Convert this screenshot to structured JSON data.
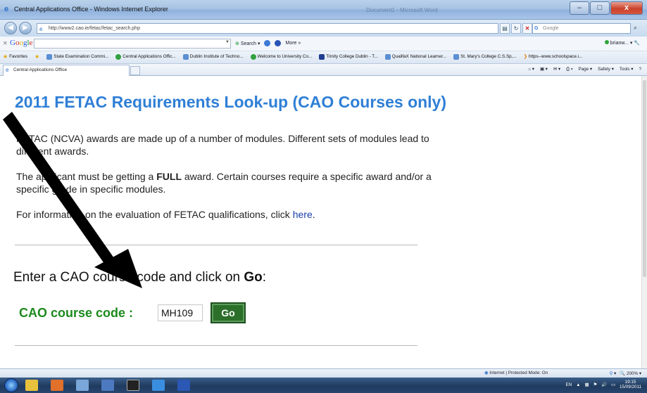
{
  "window": {
    "title": "Central Applications Office - Windows Internet Explorer",
    "ghost_tab": "Document1 - Microsoft Word",
    "minimize": "–",
    "maximize": "□",
    "close": "x"
  },
  "address_bar": {
    "url": "http://www2.cao.ie/fetac/fetac_search.php",
    "search_placeholder": "Google"
  },
  "google_toolbar": {
    "logo": [
      "G",
      "o",
      "o",
      "g",
      "l",
      "e"
    ],
    "search_label": "Search",
    "more_label": "More »",
    "user": "brianw..."
  },
  "favorites_bar": {
    "label": "Favorites",
    "items": [
      "State Examination Commi...",
      "Central Applications Offic...",
      "Dublin Institute of Techno...",
      "Welcome to University Co...",
      "Trinity College Dublin - T...",
      "QualifaX National Learner...",
      "St. Mary's College C.S.Sp,...",
      "https--www.schoolspace.i..."
    ]
  },
  "tab": {
    "label": "Central Applications Office"
  },
  "command_bar": {
    "page": "Page ▾",
    "safety": "Safety ▾",
    "tools": "Tools ▾",
    "help": "?"
  },
  "page": {
    "heading": "2011 FETAC Requirements Look-up (CAO Courses only)",
    "para1": "FETAC (NCVA) awards are made up of a number of modules. Different sets of modules lead to different awards.",
    "para2_before": "The applicant must be getting a ",
    "para2_bold": "FULL",
    "para2_after": " award. Certain courses require a specific award and/or a specific grade in specific modules.",
    "para3_before": "For information on the evaluation of FETAC qualifications, click ",
    "para3_link": "here",
    "para3_after": ".",
    "instruction_before": "Enter a CAO course code and click on ",
    "instruction_bold": "Go",
    "instruction_after": ":",
    "code_label": "CAO course code :",
    "code_value": "MH109",
    "go_button": "Go"
  },
  "status_bar": {
    "zone": "Internet | Protected Mode: On",
    "zoom": "200%"
  },
  "taskbar": {
    "language": "EN",
    "time": "19:15",
    "date": "15/09/2011"
  },
  "colors": {
    "heading": "#2f7fd6",
    "code_label": "#1d8a1d",
    "go_button": "#2b6f2b",
    "link": "#1a3fa8"
  }
}
